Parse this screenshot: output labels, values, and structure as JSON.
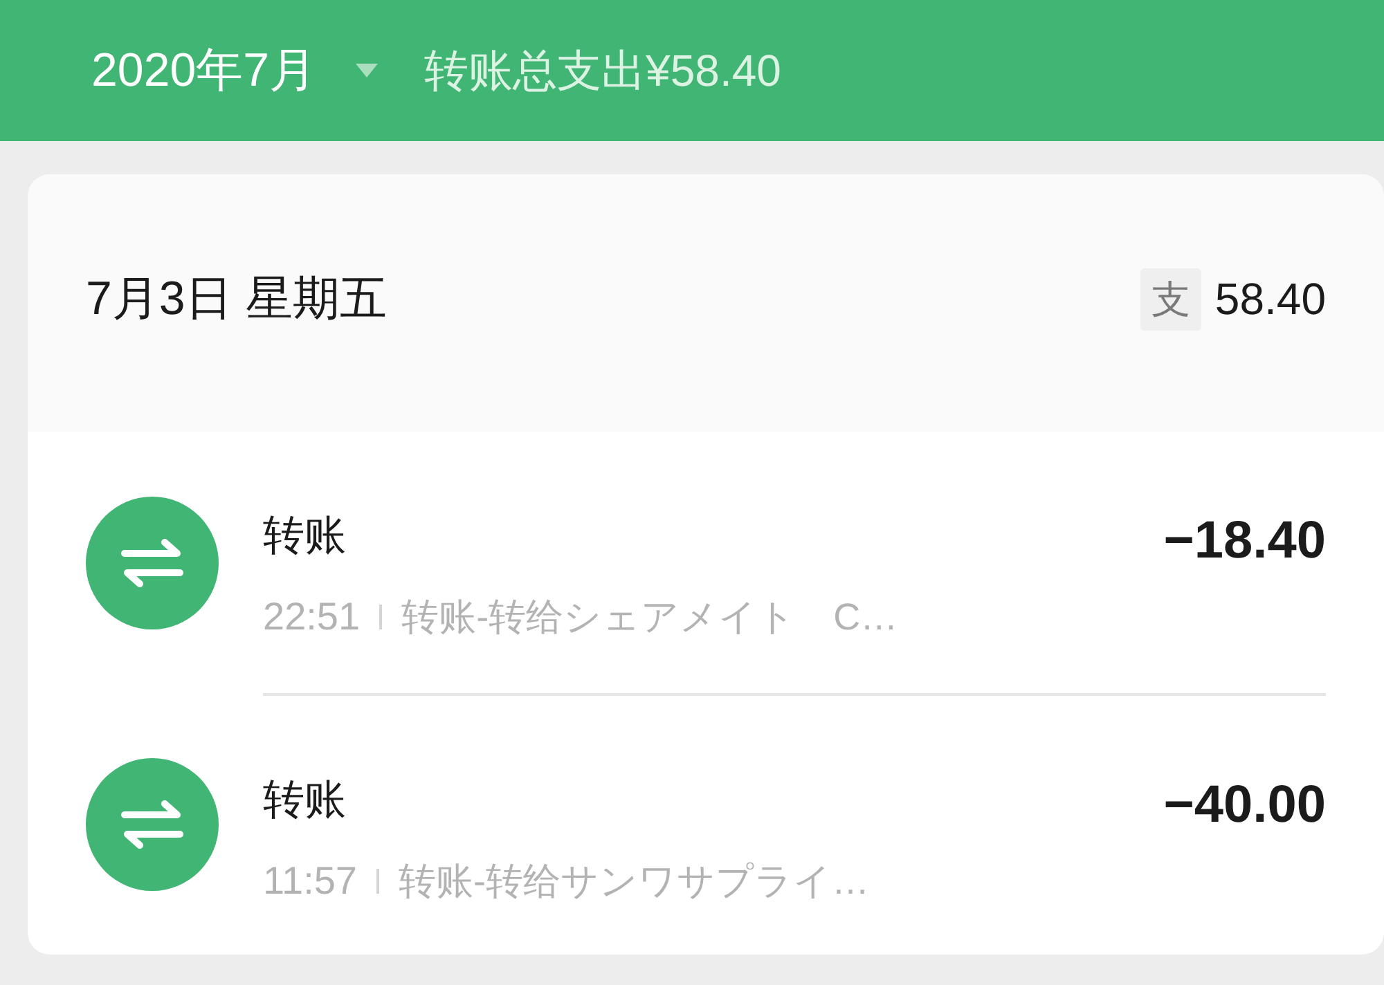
{
  "header": {
    "month": "2020年7月",
    "summary": "转账总支出¥58.40"
  },
  "day": {
    "date": "7月3日 星期五",
    "badge": "支",
    "total": "58.40"
  },
  "transactions": [
    {
      "title": "转账",
      "time": "22:51",
      "description": "转账-转给シェアメイト　C…",
      "amount": "−18.40"
    },
    {
      "title": "转账",
      "time": "11:57",
      "description": "转账-转给サンワサプライ…",
      "amount": "−40.00"
    }
  ]
}
